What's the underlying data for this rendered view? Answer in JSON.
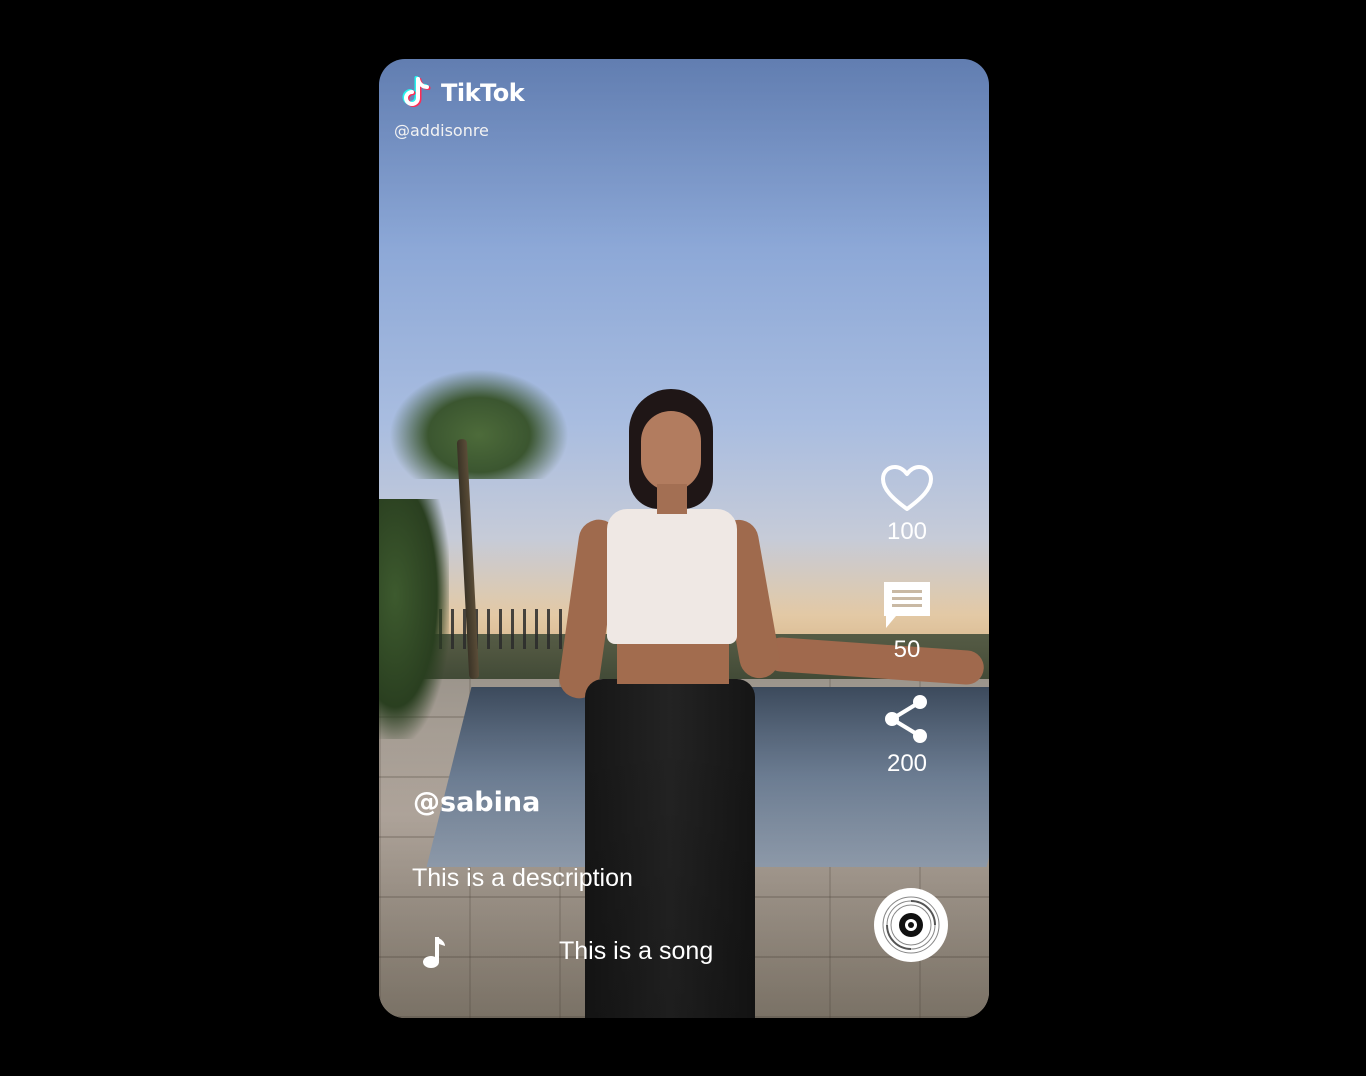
{
  "app": {
    "name": "TikTok",
    "top_handle": "@addisonre"
  },
  "video": {
    "username": "@sabina",
    "description": "This is a description",
    "song": "This is a song"
  },
  "actions": {
    "likes": "100",
    "comments": "50",
    "shares": "200"
  },
  "icons": {
    "logo": "tiktok-note-icon",
    "like": "heart-icon",
    "comment": "comment-icon",
    "share": "share-icon",
    "music": "music-note-icon",
    "record": "vinyl-record-icon"
  },
  "colors": {
    "background": "#000000",
    "text": "#ffffff",
    "logo_cyan": "#25f4ee",
    "logo_red": "#fe2c55"
  }
}
